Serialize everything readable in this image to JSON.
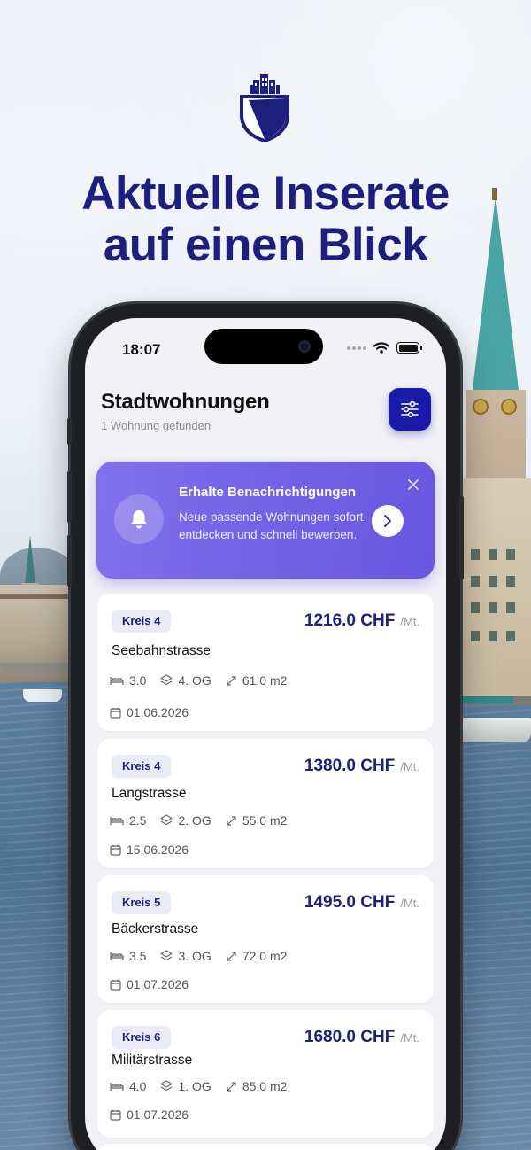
{
  "promo": {
    "headline_line1": "Aktuelle Inserate",
    "headline_line2": "auf einen Blick"
  },
  "status_bar": {
    "time": "18:07"
  },
  "header": {
    "title": "Stadtwohnungen",
    "subtitle": "1 Wohnung gefunden",
    "filter_icon": "sliders-icon"
  },
  "notification": {
    "title": "Erhalte Benachrichtigungen",
    "text": "Neue passende Wohnungen sofort entdecken und schnell bewerben.",
    "icon": "bell-icon"
  },
  "listings": [
    {
      "district": "Kreis 4",
      "price": "1216.0 CHF",
      "per": "/Mt.",
      "street": "Seebahnstrasse",
      "rooms": "3.0",
      "floor": "4. OG",
      "area": "61.0 m2",
      "date": "01.06.2026"
    },
    {
      "district": "Kreis 4",
      "price": "1380.0 CHF",
      "per": "/Mt.",
      "street": "Langstrasse",
      "rooms": "2.5",
      "floor": "2. OG",
      "area": "55.0 m2",
      "date": "15.06.2026"
    },
    {
      "district": "Kreis 5",
      "price": "1495.0 CHF",
      "per": "/Mt.",
      "street": "Bäckerstrasse",
      "rooms": "3.5",
      "floor": "3. OG",
      "area": "72.0 m2",
      "date": "01.07.2026"
    },
    {
      "district": "Kreis 6",
      "price": "1680.0 CHF",
      "per": "/Mt.",
      "street": "Militärstrasse",
      "rooms": "4.0",
      "floor": "1. OG",
      "area": "85.0 m2",
      "date": "01.07.2026"
    }
  ],
  "colors": {
    "brand_navy": "#1c1f7c",
    "filter_button": "#1a1aa8",
    "banner_purple": "#7462e6"
  }
}
